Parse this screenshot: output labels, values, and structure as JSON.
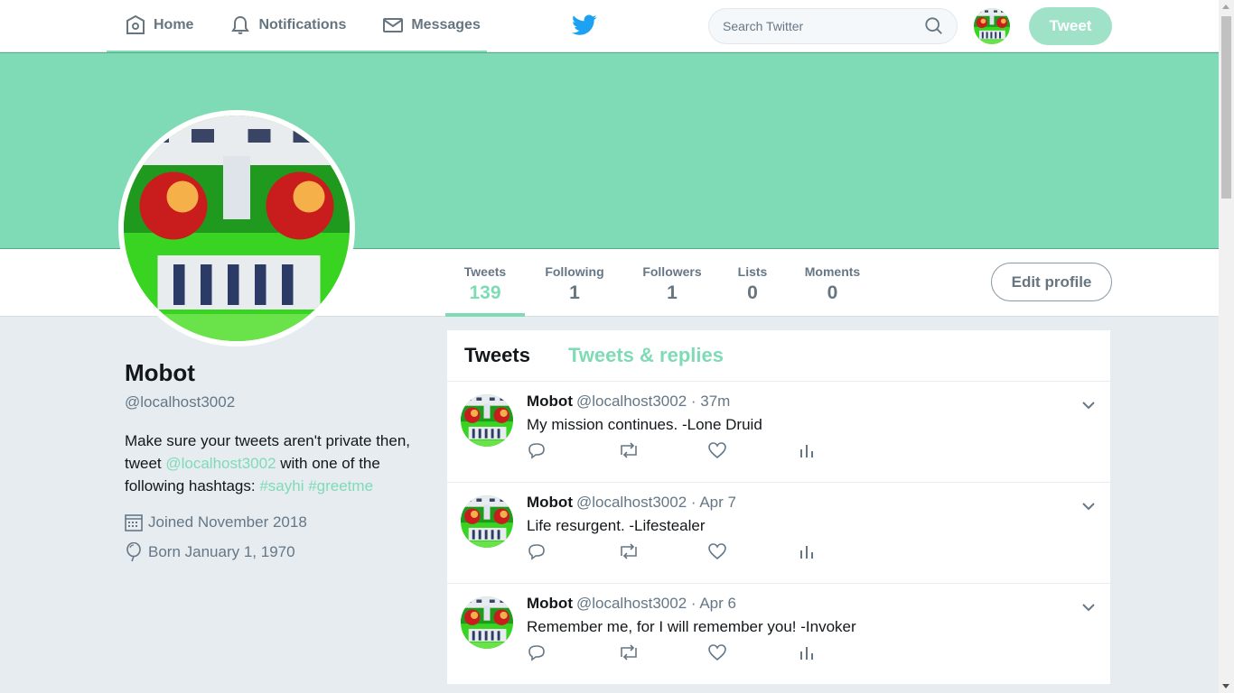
{
  "nav": {
    "items": [
      {
        "label": "Home",
        "icon": "home-icon"
      },
      {
        "label": "Notifications",
        "icon": "bell-icon"
      },
      {
        "label": "Messages",
        "icon": "envelope-icon"
      }
    ],
    "search_placeholder": "Search Twitter",
    "tweet_button": "Tweet"
  },
  "colors": {
    "accent": "#7fdbb6",
    "banner": "#7fdbb6",
    "bird": "#1da1f2"
  },
  "stats": [
    {
      "label": "Tweets",
      "value": "139"
    },
    {
      "label": "Following",
      "value": "1"
    },
    {
      "label": "Followers",
      "value": "1"
    },
    {
      "label": "Lists",
      "value": "0"
    },
    {
      "label": "Moments",
      "value": "0"
    }
  ],
  "edit_profile": "Edit profile",
  "profile": {
    "name": "Mobot",
    "handle": "@localhost3002",
    "bio_1": "Make sure your tweets aren't private then, tweet ",
    "bio_link": "@localhost3002",
    "bio_2": " with one of the following hashtags: ",
    "bio_tag1": "#sayhi",
    "bio_tag2": "#greetme",
    "joined": "Joined November 2018",
    "born": "Born January 1, 1970"
  },
  "tabs": {
    "tweets": "Tweets",
    "replies": "Tweets & replies"
  },
  "tweets": [
    {
      "name": "Mobot",
      "handle": "@localhost3002",
      "time": "· 37m",
      "text": "My mission continues. -Lone Druid"
    },
    {
      "name": "Mobot",
      "handle": "@localhost3002",
      "time": "· Apr 7",
      "text": "Life resurgent. -Lifestealer"
    },
    {
      "name": "Mobot",
      "handle": "@localhost3002",
      "time": "· Apr 6",
      "text": "Remember me, for I will remember you! -Invoker"
    }
  ]
}
